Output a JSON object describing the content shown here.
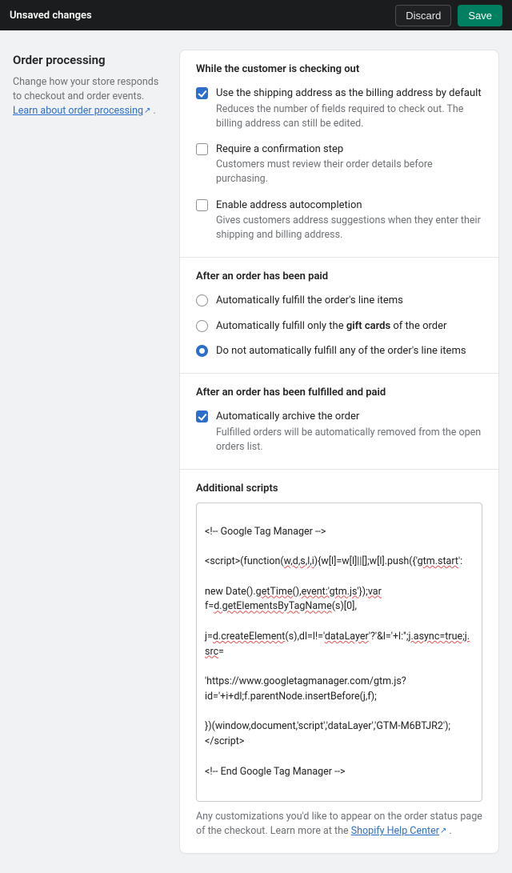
{
  "topbar": {
    "title": "Unsaved changes",
    "discard": "Discard",
    "save": "Save"
  },
  "side": {
    "heading": "Order processing",
    "desc_pre": "Change how your store responds to checkout and order events. ",
    "link": "Learn about order processing",
    "desc_post": " ."
  },
  "checkout": {
    "title": "While the customer is checking out",
    "opt1": {
      "label": "Use the shipping address as the billing address by default",
      "desc": "Reduces the number of fields required to check out. The billing address can still be edited.",
      "checked": true
    },
    "opt2": {
      "label": "Require a confirmation step",
      "desc": "Customers must review their order details before purchasing.",
      "checked": false
    },
    "opt3": {
      "label": "Enable address autocompletion",
      "desc": "Gives customers address suggestions when they enter their shipping and billing address.",
      "checked": false
    }
  },
  "paid": {
    "title": "After an order has been paid",
    "r1": {
      "label": "Automatically fulfill the order's line items"
    },
    "r2": {
      "pre": "Automatically fulfill only the ",
      "bold": "gift cards",
      "post": " of the order"
    },
    "r3": {
      "label": "Do not automatically fulfill any of the order's line items"
    },
    "selected": "r3"
  },
  "fulfilled": {
    "title": "After an order has been fulfilled and paid",
    "opt": {
      "label": "Automatically archive the order",
      "desc": "Fulfilled orders will be automatically removed from the open orders list.",
      "checked": true
    }
  },
  "scripts": {
    "title": "Additional scripts",
    "value_parts": {
      "l1": "<!-- Google Tag Manager -->",
      "l2a": "<script>(function(",
      "l2b_wavy": "w,d,s,l,i",
      "l2c": "){w[l]=w[l]||[];w[l].push({'",
      "l2d_wavy": "gtm.start",
      "l2e": "':",
      "l3a": "new Date().",
      "l3b_wavy": "getTime(),event:'gtm.js'",
      "l3c": "});",
      "l3d_wavy": "var",
      "l3e": " f=",
      "l3f_wavy": "d.getElementsByTagName",
      "l3g": "(s)[0],",
      "l4a": "j=",
      "l4b_wavy": "d.createElement",
      "l4c": "(s),dl=l!='",
      "l4d_wavy": "dataLayer",
      "l4e": "'?'&l='+l:'';",
      "l4f_wavy": "j.async=true;j.src",
      "l4g": "=",
      "l5": "'https://www.googletagmanager.com/gtm.js?id='+i+dl;f.parentNode.insertBefore(j,f);",
      "l6a": "})(window,document,'script','dataLayer','GTM-M6BTJR2');</scr",
      "l6b": "ipt>",
      "l7": "<!-- End Google Tag Manager -->"
    },
    "helper_pre": "Any customizations you'd like to appear on the order status page of the checkout. Learn more at the ",
    "helper_link": "Shopify Help Center",
    "helper_post": " ."
  }
}
